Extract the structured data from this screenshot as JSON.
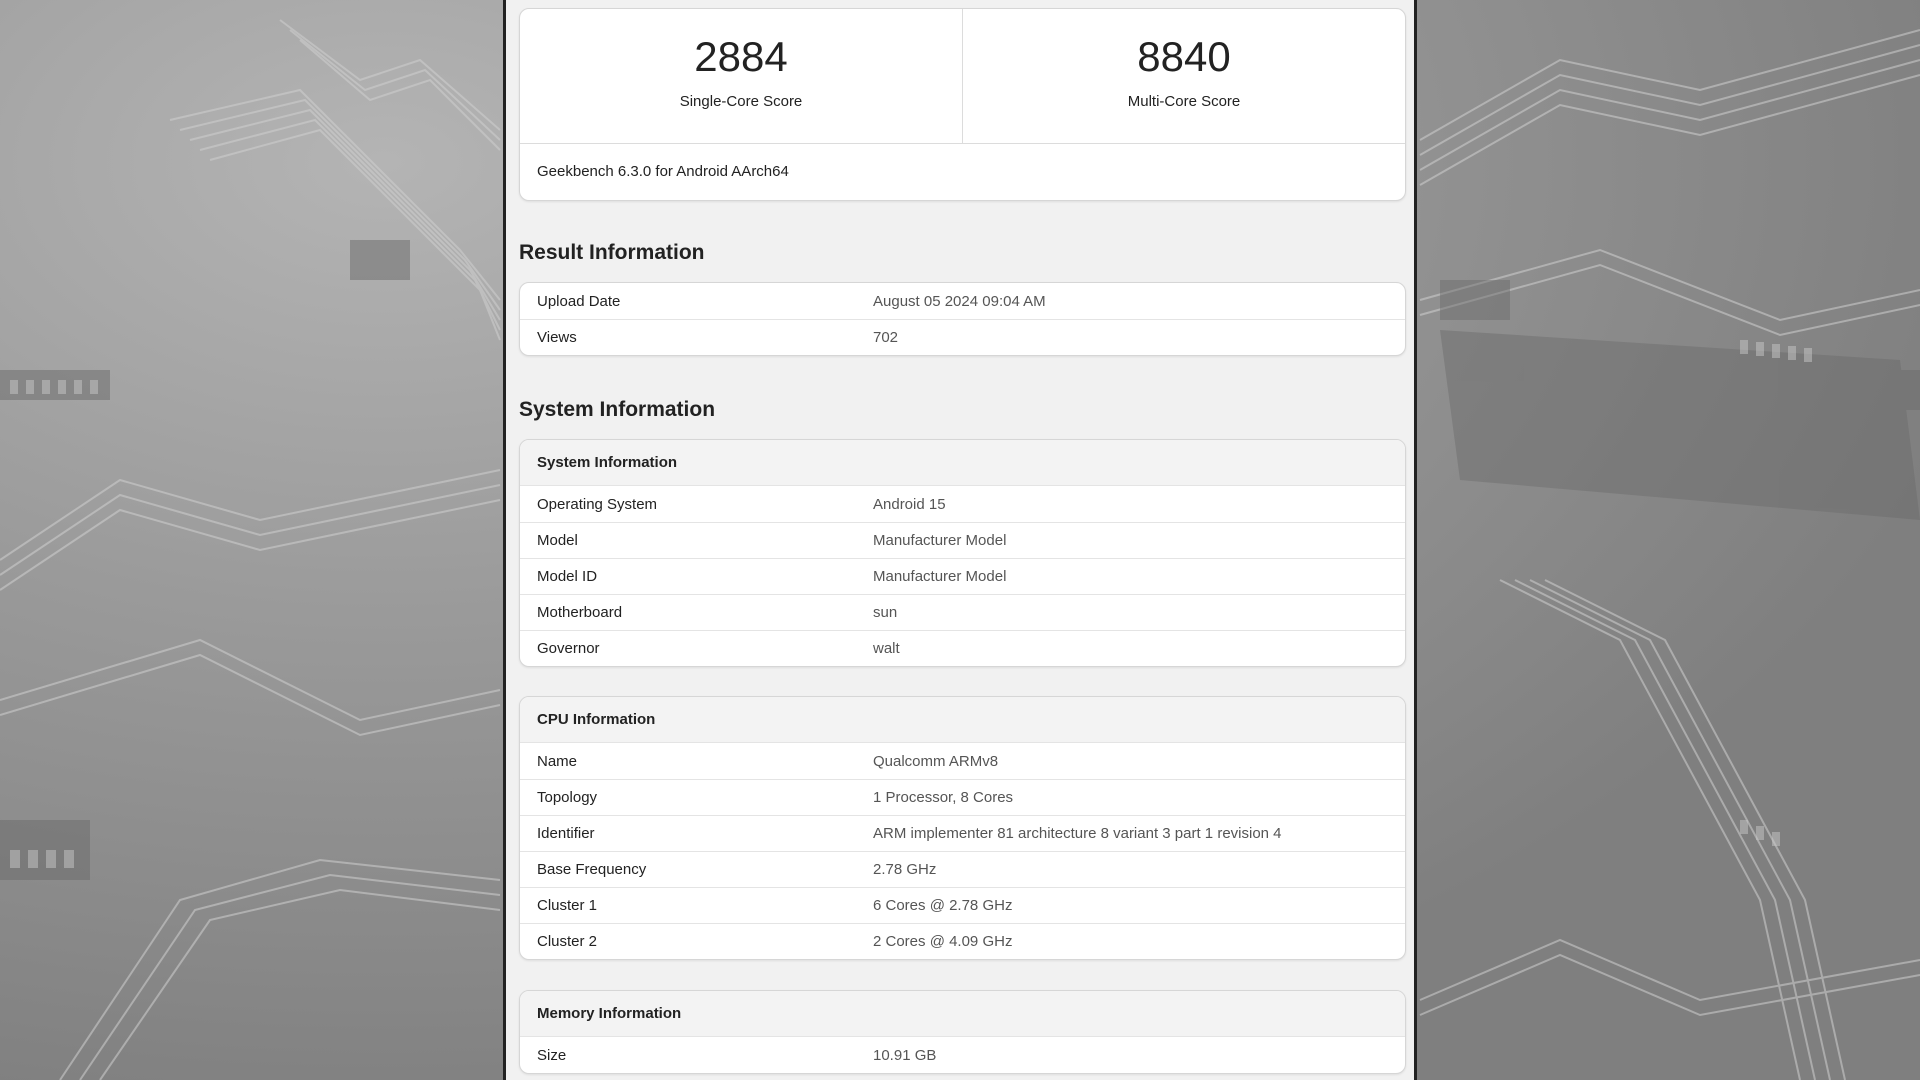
{
  "scores": {
    "single_core": {
      "value": "2884",
      "label": "Single-Core Score"
    },
    "multi_core": {
      "value": "8840",
      "label": "Multi-Core Score"
    },
    "version": "Geekbench 6.3.0 for Android AArch64"
  },
  "result_information": {
    "title": "Result Information",
    "rows": [
      {
        "key": "Upload Date",
        "value": "August 05 2024 09:04 AM"
      },
      {
        "key": "Views",
        "value": "702"
      }
    ]
  },
  "system_information": {
    "title": "System Information",
    "system": {
      "header": "System Information",
      "rows": [
        {
          "key": "Operating System",
          "value": "Android 15"
        },
        {
          "key": "Model",
          "value": "Manufacturer Model"
        },
        {
          "key": "Model ID",
          "value": "Manufacturer Model"
        },
        {
          "key": "Motherboard",
          "value": "sun"
        },
        {
          "key": "Governor",
          "value": "walt"
        }
      ]
    },
    "cpu": {
      "header": "CPU Information",
      "rows": [
        {
          "key": "Name",
          "value": "Qualcomm ARMv8"
        },
        {
          "key": "Topology",
          "value": "1 Processor, 8 Cores"
        },
        {
          "key": "Identifier",
          "value": "ARM implementer 81 architecture 8 variant 3 part 1 revision 4"
        },
        {
          "key": "Base Frequency",
          "value": "2.78 GHz"
        },
        {
          "key": "Cluster 1",
          "value": "6 Cores @ 2.78 GHz"
        },
        {
          "key": "Cluster 2",
          "value": "2 Cores @ 4.09 GHz"
        }
      ]
    },
    "memory": {
      "header": "Memory Information",
      "rows": [
        {
          "key": "Size",
          "value": "10.91 GB"
        }
      ]
    }
  }
}
